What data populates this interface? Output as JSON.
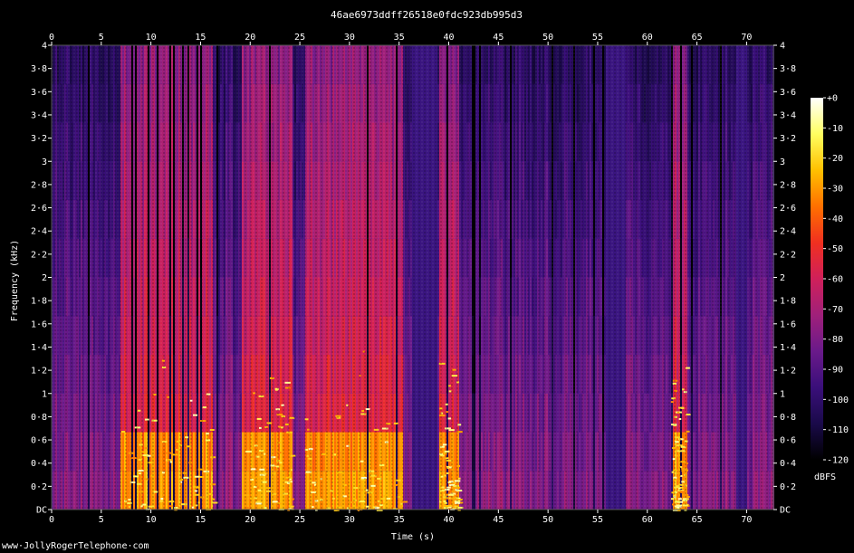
{
  "chart_data": {
    "type": "heatmap",
    "title": "46ae6973ddff26518e0fdc923db995d3",
    "xlabel": "Time (s)",
    "ylabel": "Frequency (kHz)",
    "x_ticks": [
      "0",
      "5",
      "10",
      "15",
      "20",
      "25",
      "30",
      "35",
      "40",
      "45",
      "50",
      "55",
      "60",
      "65",
      "70"
    ],
    "x_tick_values": [
      0,
      5,
      10,
      15,
      20,
      25,
      30,
      35,
      40,
      45,
      50,
      55,
      60,
      65,
      70
    ],
    "xlim": [
      0,
      72.7
    ],
    "y_ticks": [
      "DC",
      "0·2",
      "0·4",
      "0·6",
      "0·8",
      "1",
      "1·2",
      "1·4",
      "1·6",
      "1·8",
      "2",
      "2·2",
      "2·4",
      "2·6",
      "2·8",
      "3",
      "3·2",
      "3·4",
      "3·6",
      "3·8",
      "4"
    ],
    "y_tick_values": [
      0,
      0.2,
      0.4,
      0.6,
      0.8,
      1,
      1.2,
      1.4,
      1.6,
      1.8,
      2,
      2.2,
      2.4,
      2.6,
      2.8,
      3,
      3.2,
      3.4,
      3.6,
      3.8,
      4
    ],
    "ylim": [
      0,
      4
    ],
    "colorbar": {
      "label": "dBFS",
      "ticks": [
        "+0",
        "-10",
        "-20",
        "-30",
        "-40",
        "-50",
        "-60",
        "-70",
        "-80",
        "-90",
        "-100",
        "-110",
        "-120"
      ],
      "tick_values": [
        0,
        -10,
        -20,
        -30,
        -40,
        -50,
        -60,
        -70,
        -80,
        -90,
        -100,
        -110,
        -120
      ],
      "range": [
        -120,
        0
      ]
    },
    "colormap": [
      "#000000",
      "#1a0a4a",
      "#3a0f7a",
      "#6a1a8a",
      "#a0207a",
      "#d0205a",
      "#f03020",
      "#ff7000",
      "#ffc000",
      "#ffff60",
      "#ffffff"
    ],
    "silent_intervals_s": [
      [
        36.2,
        38.8
      ],
      [
        55.8,
        57.8
      ],
      [
        68.9,
        69.9
      ]
    ],
    "loud_intervals_s": [
      [
        6.8,
        16.2
      ],
      [
        19.0,
        24.2
      ],
      [
        25.5,
        35.3
      ],
      [
        39.0,
        41.0
      ],
      [
        62.3,
        64.0
      ]
    ]
  },
  "watermark": "www·JollyRogerTelephone·com"
}
